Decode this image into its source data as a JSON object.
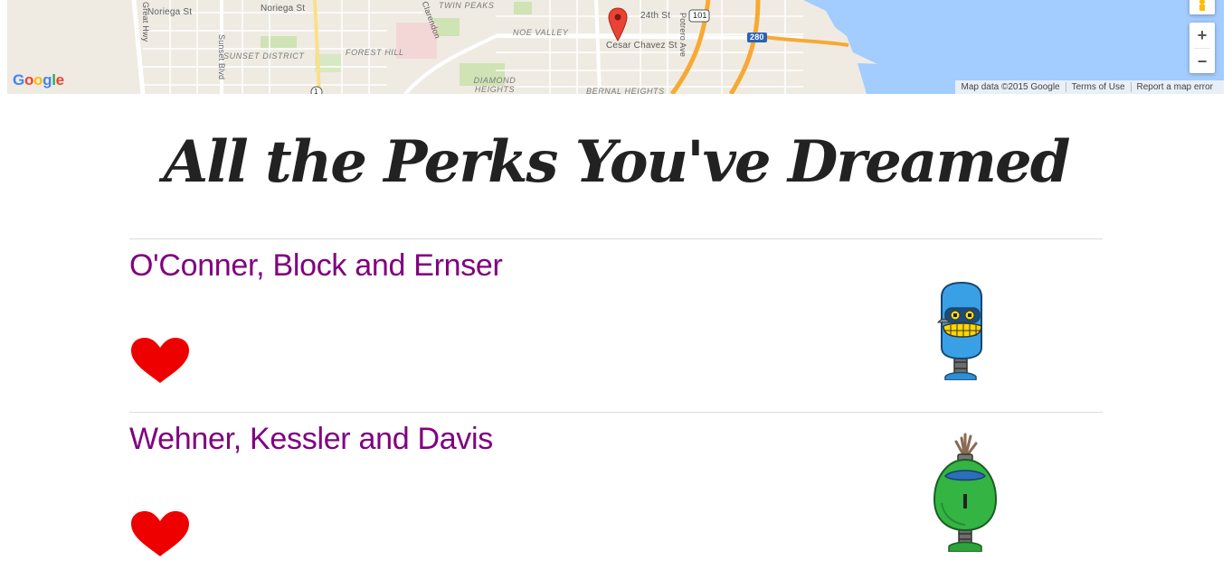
{
  "map": {
    "streets": [
      "Noriega St",
      "Noriega St",
      "Great Hwy",
      "Sunset Blvd",
      "Clarendon",
      "24th St",
      "Cesar Chavez St",
      "Potrero Ave"
    ],
    "areas": [
      "Sunset District",
      "Forest Hill",
      "Twin Peaks",
      "Noe Valley",
      "Diamond Heights",
      "Bernal Heights"
    ],
    "shields": [
      "101",
      "280",
      "1"
    ],
    "logo_text": "Google",
    "attribution": [
      "Map data ©2015 Google",
      "Terms of Use",
      "Report a map error"
    ],
    "zoom_in": "+",
    "zoom_out": "−",
    "colors": {
      "land": "#efebe2",
      "water": "#a3ccff",
      "park": "#cfe3b5",
      "highway": "#f7a935",
      "marker": "#ea4335"
    }
  },
  "heading": "All the Perks You've Dreamed",
  "listings": [
    {
      "company": "O'Conner, Block and Ernser",
      "favorite_icon": "heart-icon",
      "avatar": "blue-robot"
    },
    {
      "company": "Wehner, Kessler and Davis",
      "favorite_icon": "heart-icon",
      "avatar": "green-robot"
    }
  ],
  "colors": {
    "link": "#800080",
    "heart": "#ee0000",
    "heading": "#222222",
    "divider": "#dcdcdc"
  }
}
